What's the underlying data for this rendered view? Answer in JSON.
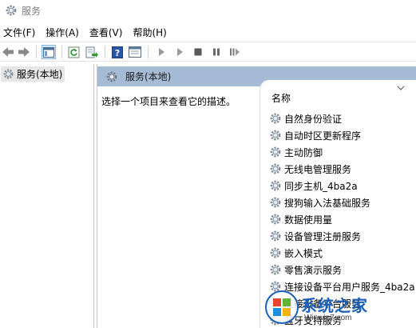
{
  "window": {
    "title": "服务"
  },
  "menu": {
    "items": [
      "文件(F)",
      "操作(A)",
      "查看(V)",
      "帮助(H)"
    ]
  },
  "toolbar": {
    "buttons": [
      "back-arrow-icon",
      "forward-arrow-icon",
      "show-hide-tree-icon",
      "refresh-icon",
      "export-list-icon",
      "help-icon",
      "properties-icon",
      "start-service-icon",
      "stop-service-icon",
      "pause-service-icon",
      "resume-service-icon"
    ]
  },
  "tree": {
    "root_label": "服务(本地)"
  },
  "details": {
    "header_label": "服务(本地)",
    "description": "选择一个项目来查看它的描述。",
    "column_name": "名称",
    "services": [
      "自然身份验证",
      "自动时区更新程序",
      "主动防御",
      "无线电管理服务",
      "同步主机_4ba2a",
      "搜狗输入法基础服务",
      "数据使用量",
      "设备管理注册服务",
      "嵌入模式",
      "零售演示服务",
      "连接设备平台用户服务_4ba2a",
      "连接设备平台服务",
      "蓝牙支持服务"
    ]
  },
  "watermark": {
    "text": "系统之家",
    "sub": "Winwin7.com"
  },
  "colors": {
    "header_bg": "#a6bcd6",
    "selected_bg": "#e6e6e6",
    "accent": "#1d5fb4"
  }
}
